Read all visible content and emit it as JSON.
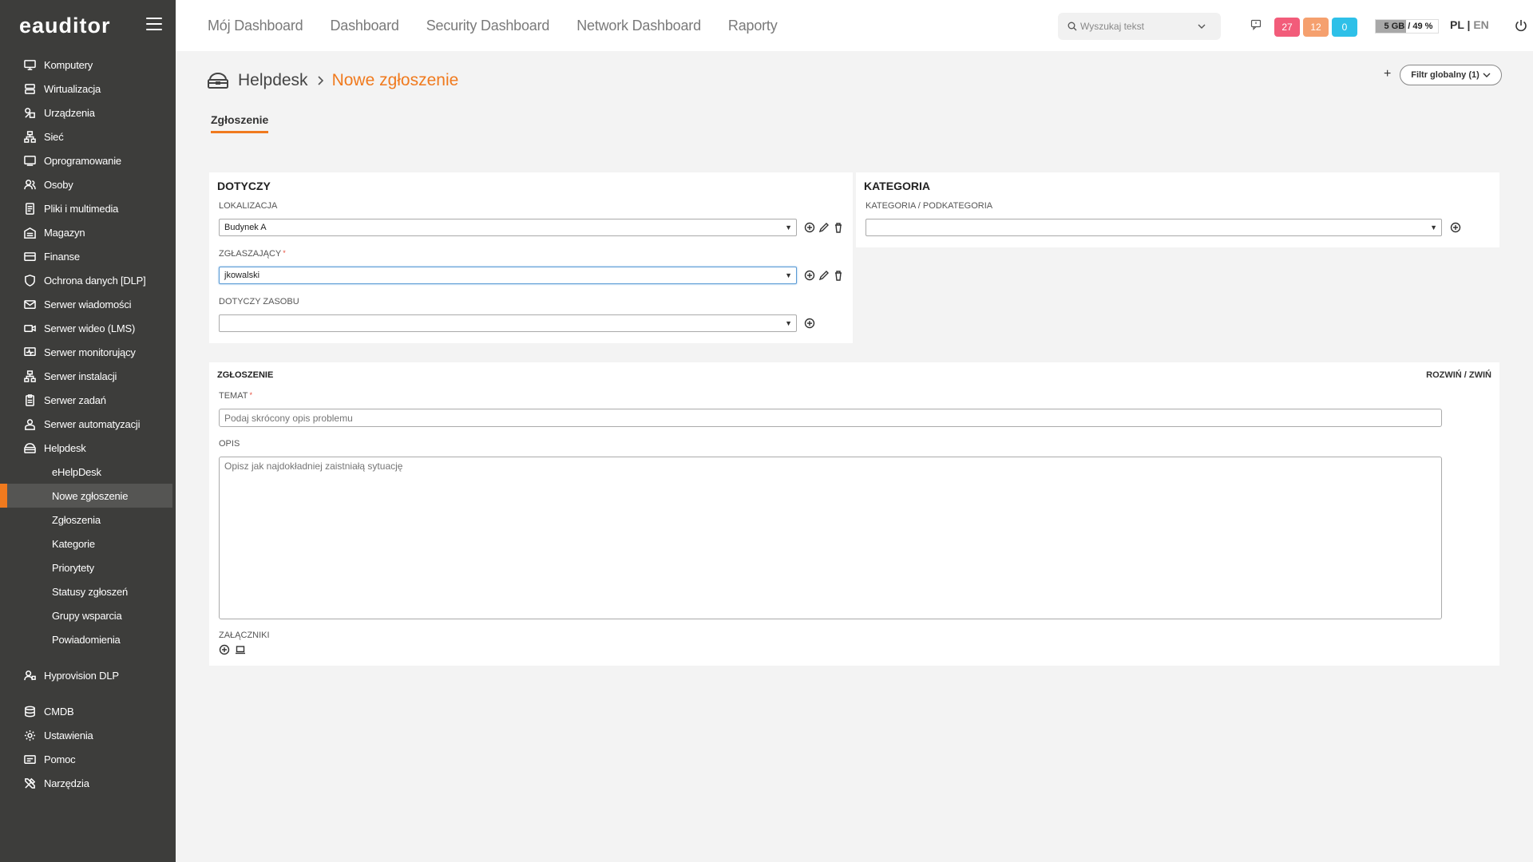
{
  "app": {
    "logo": "eauditor"
  },
  "sidebar": {
    "items": [
      {
        "label": "Komputery",
        "icon": "monitor-icon"
      },
      {
        "label": "Wirtualizacja",
        "icon": "server-icon"
      },
      {
        "label": "Urządzenia",
        "icon": "devices-icon"
      },
      {
        "label": "Sieć",
        "icon": "network-icon"
      },
      {
        "label": "Oprogramowanie",
        "icon": "software-icon"
      },
      {
        "label": "Osoby",
        "icon": "users-icon"
      },
      {
        "label": "Pliki i multimedia",
        "icon": "files-icon"
      },
      {
        "label": "Magazyn",
        "icon": "warehouse-icon"
      },
      {
        "label": "Finanse",
        "icon": "finance-icon"
      },
      {
        "label": "Ochrona danych [DLP]",
        "icon": "shield-icon"
      },
      {
        "label": "Serwer wiadomości",
        "icon": "mail-icon"
      },
      {
        "label": "Serwer wideo (LMS)",
        "icon": "video-icon"
      },
      {
        "label": "Serwer monitorujący",
        "icon": "monitoring-icon"
      },
      {
        "label": "Serwer instalacji",
        "icon": "install-icon"
      },
      {
        "label": "Serwer zadań",
        "icon": "tasks-icon"
      },
      {
        "label": "Serwer automatyzacji",
        "icon": "automation-icon"
      },
      {
        "label": "Helpdesk",
        "icon": "helpdesk-icon"
      }
    ],
    "helpdesk_sub": [
      {
        "label": "eHelpDesk"
      },
      {
        "label": "Nowe zgłoszenie"
      },
      {
        "label": "Zgłoszenia"
      },
      {
        "label": "Kategorie"
      },
      {
        "label": "Priorytety"
      },
      {
        "label": "Statusy zgłoszeń"
      },
      {
        "label": "Grupy wsparcia"
      },
      {
        "label": "Powiadomienia"
      }
    ],
    "bottom": [
      {
        "label": "Hyprovision DLP",
        "icon": "hyprovision-icon"
      },
      {
        "label": "CMDB",
        "icon": "database-icon"
      },
      {
        "label": "Ustawienia",
        "icon": "gear-icon"
      },
      {
        "label": "Pomoc",
        "icon": "help-icon"
      },
      {
        "label": "Narzędzia",
        "icon": "tools-icon"
      }
    ]
  },
  "topbar": {
    "tabs": [
      "Mój Dashboard",
      "Dashboard",
      "Security Dashboard",
      "Network Dashboard",
      "Raporty"
    ],
    "search_placeholder": "Wyszukaj tekst",
    "badges": [
      {
        "value": "27",
        "color": "#f25c7a"
      },
      {
        "value": "12",
        "color": "#f5a06e"
      },
      {
        "value": "0",
        "color": "#2ec0e8"
      }
    ],
    "storage_size": "5 GB",
    "storage_percent": "/ 49 %",
    "storage_fill": 0.49,
    "lang_pl": "PL",
    "lang_sep": "|",
    "lang_en": "EN"
  },
  "page": {
    "breadcrumb_root": "Helpdesk",
    "breadcrumb_current": "Nowe zgłoszenie",
    "filter_label": "Filtr globalny (1)",
    "tab_label": "Zgłoszenie"
  },
  "dotyczy": {
    "title": "DOTYCZY",
    "lokalizacja_label": "LOKALIZACJA",
    "lokalizacja_value": "Budynek A",
    "zglaszajacy_label": "ZGŁASZAJĄCY",
    "zglaszajacy_value": "jkowalski",
    "zasob_label": "DOTYCZY ZASOBU",
    "zasob_value": ""
  },
  "kategoria": {
    "title": "KATEGORIA",
    "label": "KATEGORIA / PODKATEGORIA",
    "value": ""
  },
  "zgloszenie": {
    "title": "ZGŁOSZENIE",
    "expand_label": "ROZWIŃ / ZWIŃ",
    "temat_label": "TEMAT",
    "temat_placeholder": "Podaj skrócony opis problemu",
    "opis_label": "OPIS",
    "opis_placeholder": "Opisz jak najdokładniej zaistniałą sytuację",
    "zalaczniki_label": "ZAŁĄCZNIKI"
  },
  "required_mark": "*",
  "accent_color": "#f07a1e"
}
